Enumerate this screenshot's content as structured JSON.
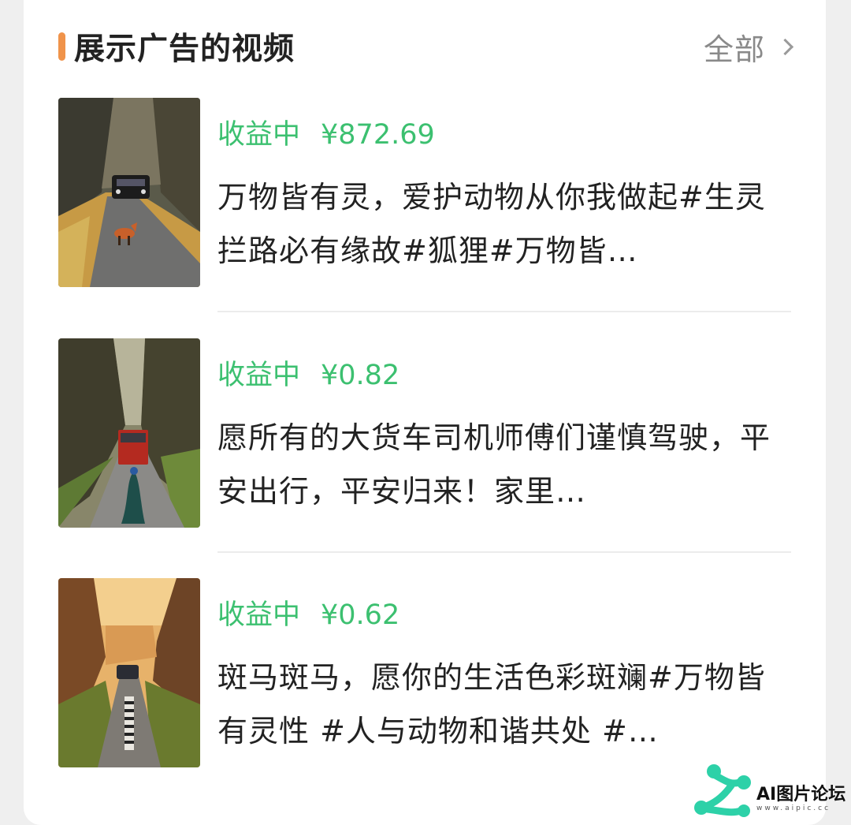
{
  "section": {
    "title": "展示广告的视频",
    "view_all_label": "全部",
    "accent_color": "#f0934a"
  },
  "videos": [
    {
      "status": "收益中",
      "amount": "¥872.69",
      "description": "万物皆有灵，爱护动物从你我做起#生灵拦路必有缘故#狐狸#万物皆…",
      "thumbnail": "fox-on-road-with-suv"
    },
    {
      "status": "收益中",
      "amount": "¥0.82",
      "description": "愿所有的大货车司机师傅们谨慎驾驶，平安出行，平安归来！家里…",
      "thumbnail": "peacock-on-road-with-truck"
    },
    {
      "status": "收益中",
      "amount": "¥0.62",
      "description": "斑马斑马，愿你的生活色彩斑斓#万物皆有灵性 #人与动物和谐共处 #…",
      "thumbnail": "zebra-on-road-with-car"
    }
  ],
  "colors": {
    "earning_green": "#3cc070",
    "title_text": "#222222",
    "muted_text": "#8a8a8a"
  },
  "watermark": {
    "text": "AI图片论坛",
    "url": "www.aipic.cc"
  }
}
